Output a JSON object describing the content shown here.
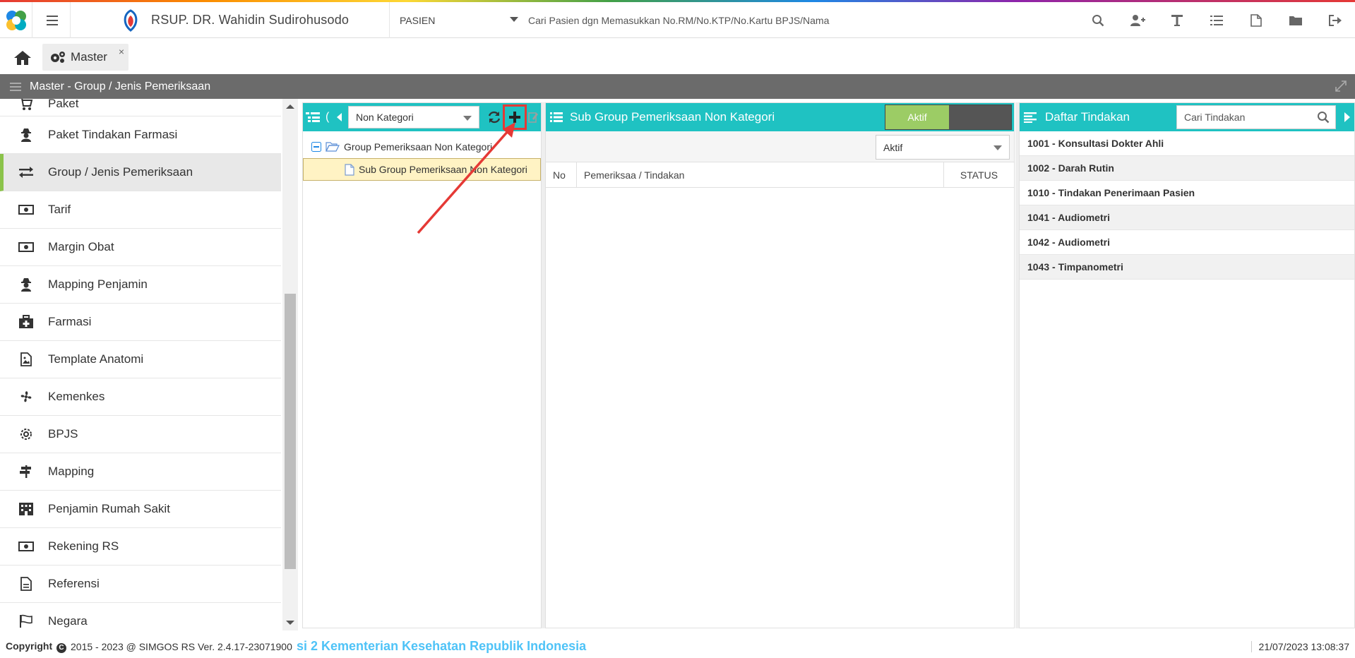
{
  "header": {
    "hospital_name": "RSUP. DR. Wahidin Sudirohusodo",
    "category": "PASIEN",
    "search_placeholder": "Cari Pasien dgn Memasukkan No.RM/No.KTP/No.Kartu BPJS/Nama",
    "icons": [
      "search-icon",
      "add-user-icon",
      "text-icon",
      "list-icon",
      "pdf-icon",
      "folder-icon",
      "logout-icon"
    ]
  },
  "tabs": {
    "master_label": "Master",
    "close": "×"
  },
  "page": {
    "title": "Master - Group / Jenis Pemeriksaan"
  },
  "sidebar": {
    "items": [
      {
        "label": "Paket",
        "icon": "cart-icon"
      },
      {
        "label": "Paket Tindakan Farmasi",
        "icon": "user-secret-icon"
      },
      {
        "label": "Group / Jenis Pemeriksaan",
        "icon": "exchange-icon",
        "active": true
      },
      {
        "label": "Tarif",
        "icon": "money-icon"
      },
      {
        "label": "Margin Obat",
        "icon": "money-icon"
      },
      {
        "label": "Mapping Penjamin",
        "icon": "user-secret-icon"
      },
      {
        "label": "Farmasi",
        "icon": "medkit-icon"
      },
      {
        "label": "Template Anatomi",
        "icon": "image-file-icon"
      },
      {
        "label": "Kemenkes",
        "icon": "fan-icon"
      },
      {
        "label": "BPJS",
        "icon": "gear-dotted-icon"
      },
      {
        "label": "Mapping",
        "icon": "signpost-icon"
      },
      {
        "label": "Penjamin Rumah Sakit",
        "icon": "building-icon"
      },
      {
        "label": "Rekening RS",
        "icon": "money-icon"
      },
      {
        "label": "Referensi",
        "icon": "file-icon"
      },
      {
        "label": "Negara",
        "icon": "flag-icon"
      }
    ]
  },
  "tree_panel": {
    "header_partial": "(",
    "category_value": "Non Kategori",
    "group": "Group Pemeriksaan Non Kategori",
    "subgroup": "Sub Group Pemeriksaan Non Kategori"
  },
  "detail_panel": {
    "title": "Sub Group Pemeriksaan Non Kategori",
    "toggle_on": "Aktif",
    "status_value": "Aktif",
    "columns": [
      "No",
      "Pemeriksaa / Tindakan",
      "STATUS"
    ]
  },
  "tindakan_panel": {
    "title": "Daftar Tindakan",
    "search_placeholder": "Cari Tindakan",
    "items": [
      "1001 - Konsultasi Dokter Ahli",
      "1002 - Darah Rutin",
      "1010 - Tindakan Penerimaan Pasien",
      "1041 - Audiometri",
      "1042 - Audiometri",
      "1043 - Timpanometri"
    ]
  },
  "footer": {
    "copyright": "Copyright",
    "symbol": "C",
    "version": "2015 - 2023 @ SIMGOS RS Ver. 2.4.17-23071900",
    "marquee": "si 2 Kementerian Kesehatan Republik Indonesia",
    "datetime": "21/07/2023 13:08:37"
  },
  "colors": {
    "panel_header": "#1fc2c2",
    "active_accent": "#8bc34a",
    "toggle_on": "#9ccc65",
    "highlight": "#e53935",
    "marquee": "#4fc3f7"
  }
}
